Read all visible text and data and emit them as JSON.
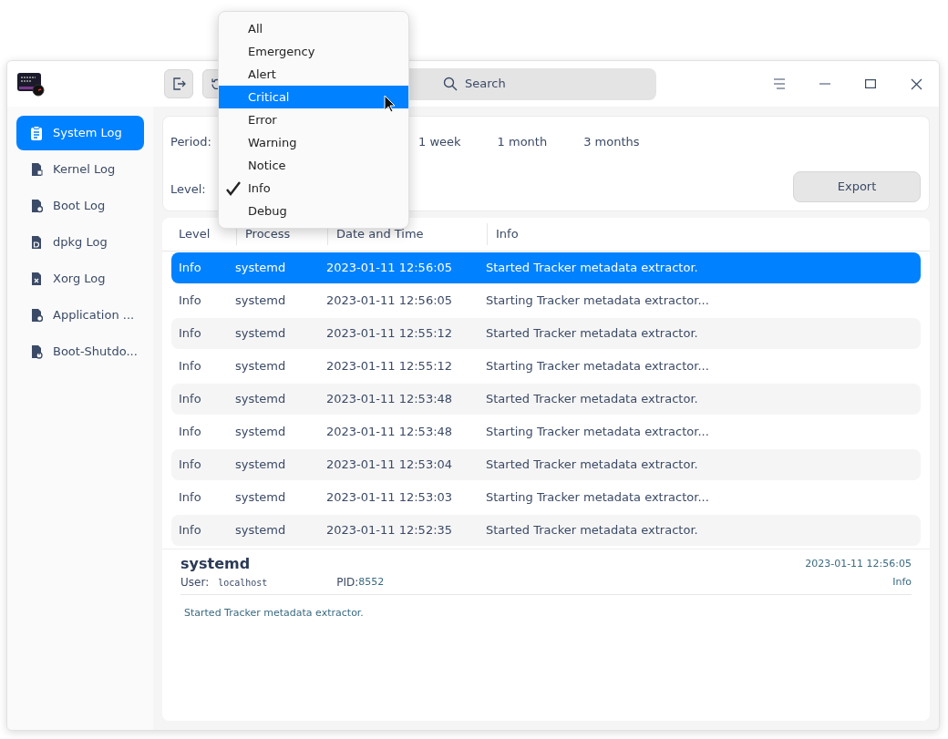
{
  "window": {
    "search": {
      "placeholder": "Search"
    }
  },
  "sidebar": {
    "items": [
      {
        "label": "System Log",
        "selected": true
      },
      {
        "label": "Kernel Log",
        "selected": false
      },
      {
        "label": "Boot Log",
        "selected": false
      },
      {
        "label": "dpkg Log",
        "selected": false
      },
      {
        "label": "Xorg Log",
        "selected": false
      },
      {
        "label": "Application ...",
        "selected": false
      },
      {
        "label": "Boot-Shutdo...",
        "selected": false
      }
    ]
  },
  "filters": {
    "period_label": "Period:",
    "period_options": [
      "1 week",
      "1 month",
      "3 months"
    ],
    "level_label": "Level:",
    "export_button": "Export"
  },
  "table": {
    "columns": [
      "Level",
      "Process",
      "Date and Time",
      "Info"
    ],
    "rows": [
      {
        "cells": [
          "Info",
          "systemd",
          "2023-01-11 12:56:05",
          "Started Tracker metadata extractor."
        ],
        "selected": true
      },
      {
        "cells": [
          "Info",
          "systemd",
          "2023-01-11 12:56:05",
          "Starting Tracker metadata extractor..."
        ],
        "selected": false
      },
      {
        "cells": [
          "Info",
          "systemd",
          "2023-01-11 12:55:12",
          "Started Tracker metadata extractor."
        ],
        "selected": false
      },
      {
        "cells": [
          "Info",
          "systemd",
          "2023-01-11 12:55:12",
          "Starting Tracker metadata extractor..."
        ],
        "selected": false
      },
      {
        "cells": [
          "Info",
          "systemd",
          "2023-01-11 12:53:48",
          "Started Tracker metadata extractor."
        ],
        "selected": false
      },
      {
        "cells": [
          "Info",
          "systemd",
          "2023-01-11 12:53:48",
          "Starting Tracker metadata extractor..."
        ],
        "selected": false
      },
      {
        "cells": [
          "Info",
          "systemd",
          "2023-01-11 12:53:04",
          "Started Tracker metadata extractor."
        ],
        "selected": false
      },
      {
        "cells": [
          "Info",
          "systemd",
          "2023-01-11 12:53:03",
          "Starting Tracker metadata extractor..."
        ],
        "selected": false
      },
      {
        "cells": [
          "Info",
          "systemd",
          "2023-01-11 12:52:35",
          "Started Tracker metadata extractor."
        ],
        "selected": false
      }
    ]
  },
  "details": {
    "process": "systemd",
    "date": "2023-01-11 12:56:05",
    "user_label": "User:",
    "user": "localhost",
    "pid_label": "PID:",
    "pid": "8552",
    "level": "Info",
    "message": "Started Tracker metadata extractor."
  },
  "level_menu": {
    "items": [
      {
        "label": "All",
        "checked": false,
        "selected": false
      },
      {
        "label": "Emergency",
        "checked": false,
        "selected": false
      },
      {
        "label": "Alert",
        "checked": false,
        "selected": false
      },
      {
        "label": "Critical",
        "checked": false,
        "selected": true
      },
      {
        "label": "Error",
        "checked": false,
        "selected": false
      },
      {
        "label": "Warning",
        "checked": false,
        "selected": false
      },
      {
        "label": "Notice",
        "checked": false,
        "selected": false
      },
      {
        "label": "Info",
        "checked": true,
        "selected": false
      },
      {
        "label": "Debug",
        "checked": false,
        "selected": false
      }
    ]
  }
}
